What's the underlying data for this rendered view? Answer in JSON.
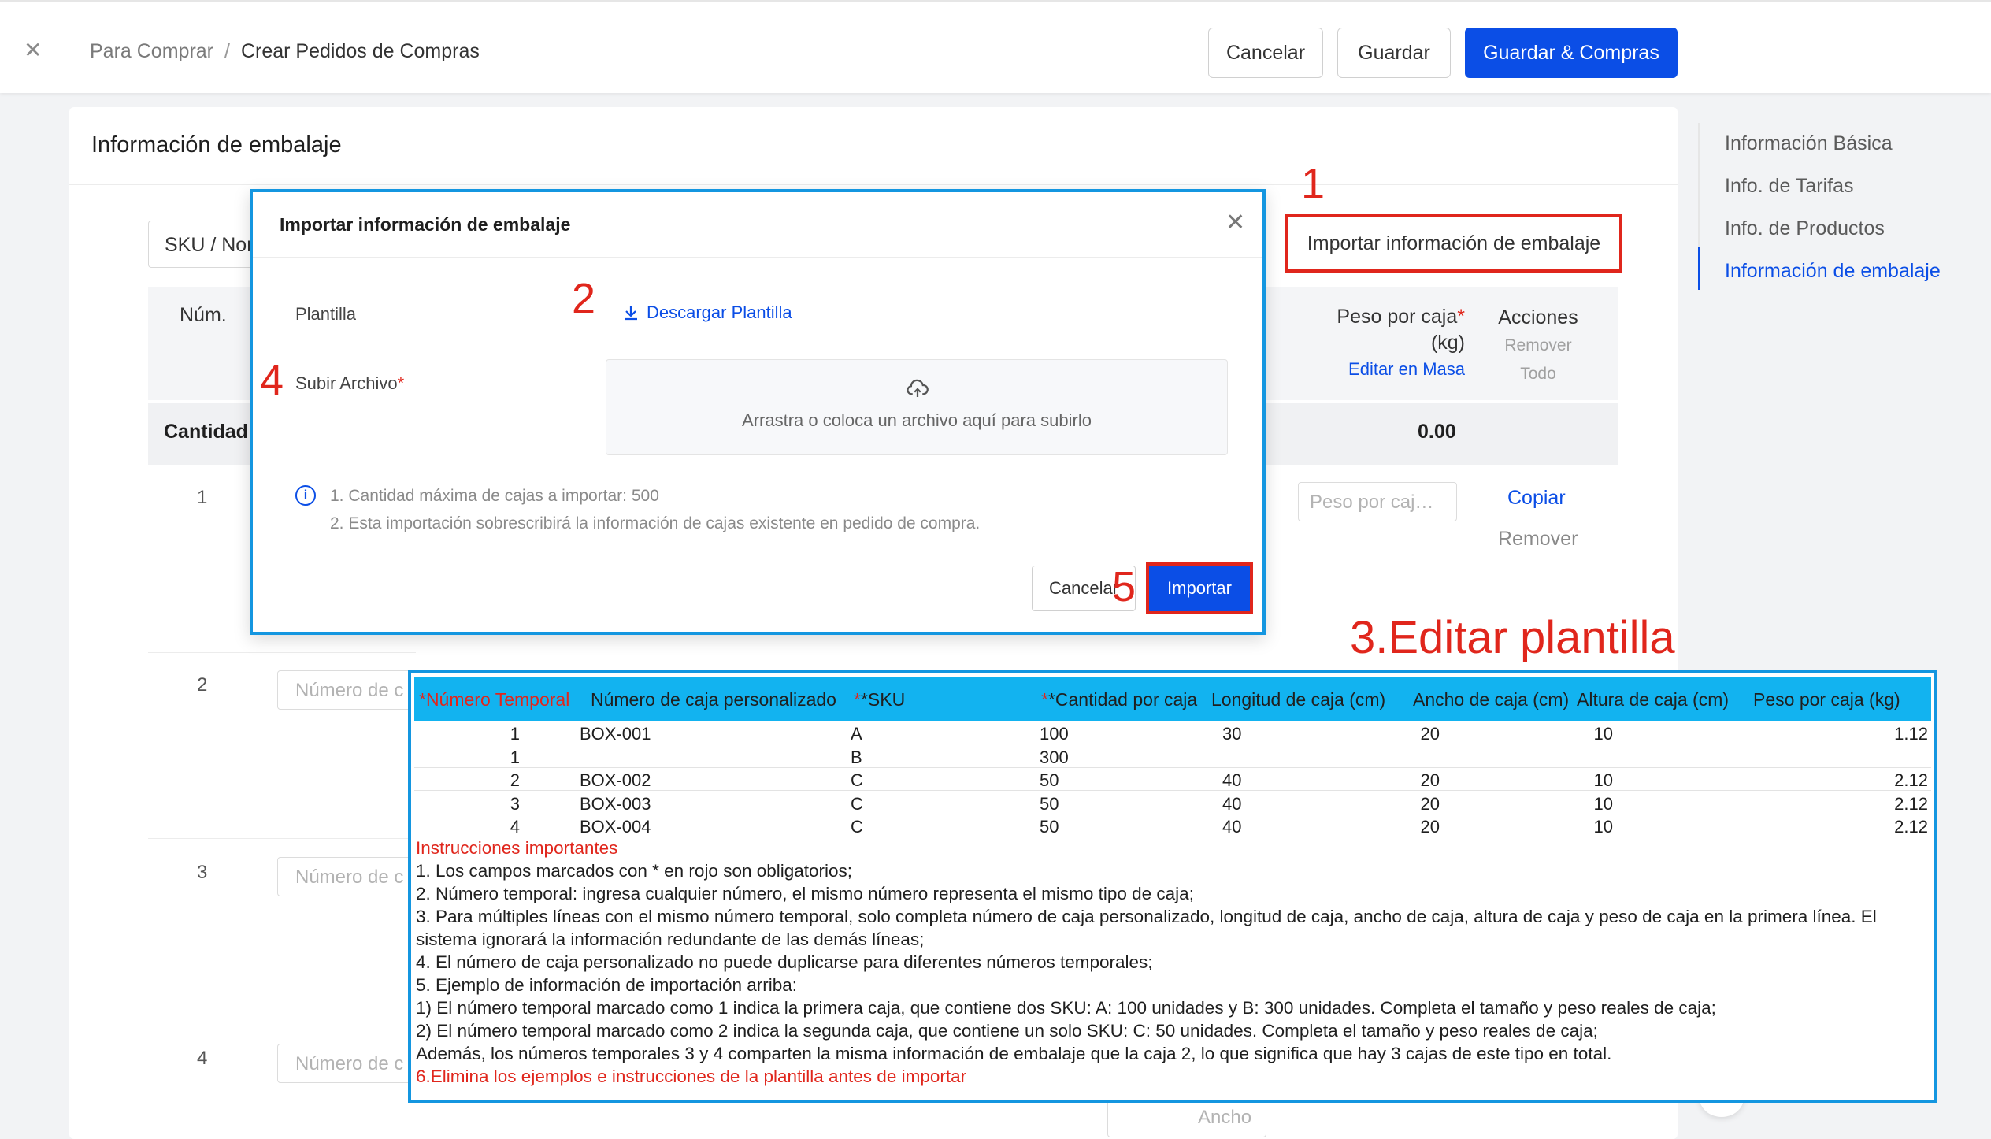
{
  "header": {
    "close_icon": "close-icon",
    "breadcrumb": [
      "Para Comprar",
      "Crear Pedidos de Compras"
    ],
    "breadcrumb_sep": "/",
    "cancel_label": "Cancelar",
    "save_label": "Guardar",
    "save_purchase_label": "Guardar & Compras"
  },
  "card": {
    "title": "Información de embalaje",
    "sku_select": "SKU / Nom",
    "import_button": "Importar información de embalaje",
    "col_num": "Núm.",
    "col_weight": "Peso por caja",
    "col_weight_req": "*",
    "col_weight_unit": "(kg)",
    "col_weight_edit": "Editar en Masa",
    "col_actions": "Acciones",
    "col_actions_remove1": "Remover",
    "col_actions_remove2": "Todo",
    "sum_label": "Cantidad",
    "sum_value": "0.00",
    "rows": [
      {
        "num": "1",
        "weight_placeholder": "Peso por caj…",
        "copy": "Copiar",
        "remove": "Remover"
      },
      {
        "num": "2",
        "box_placeholder": "Número de c"
      },
      {
        "num": "3",
        "box_placeholder": "Número de c"
      },
      {
        "num": "4",
        "box_placeholder": "Número de c"
      }
    ],
    "ancho_placeholder": "Ancho"
  },
  "anchor_nav": {
    "items": [
      "Información Básica",
      "Info. de Tarifas",
      "Info. de Productos",
      "Información de embalaje"
    ],
    "active_index": 3
  },
  "modal": {
    "title": "Importar información de embalaje",
    "template_label": "Plantilla",
    "download_label": "Descargar Plantilla",
    "upload_label": "Subir Archivo",
    "upload_req": "*",
    "dropzone_text": "Arrastra o coloca un archivo aquí para subirlo",
    "note1": "1. Cantidad máxima de cajas a importar: 500",
    "note2": "2. Esta importación sobrescribirá la información de cajas existente en pedido de compra.",
    "cancel_label": "Cancelar",
    "import_label": "Importar"
  },
  "annotations": {
    "step1": "1",
    "step2": "2",
    "step3": "3.Editar plantilla",
    "step4": "4",
    "step5": "5"
  },
  "sheet": {
    "headers": [
      "*Número Temporal",
      "Número de caja personalizado",
      "*SKU",
      "*Cantidad por caja",
      "Longitud de caja (cm)",
      "Ancho de caja (cm)",
      "Altura de caja (cm)",
      "Peso por caja (kg)"
    ],
    "rows": [
      [
        "1",
        "BOX-001",
        "A",
        "100",
        "30",
        "20",
        "10",
        "1.12"
      ],
      [
        "1",
        "",
        "B",
        "300",
        "",
        "",
        "",
        ""
      ],
      [
        "2",
        "BOX-002",
        "C",
        "50",
        "40",
        "20",
        "10",
        "2.12"
      ],
      [
        "3",
        "BOX-003",
        "C",
        "50",
        "40",
        "20",
        "10",
        "2.12"
      ],
      [
        "4",
        "BOX-004",
        "C",
        "50",
        "40",
        "20",
        "10",
        "2.12"
      ]
    ],
    "instr_title": "Instrucciones importantes",
    "instr": [
      "1. Los campos marcados con * en rojo son obligatorios;",
      "2. Número temporal: ingresa cualquier número, el mismo número representa el mismo tipo de caja;",
      "3. Para múltiples líneas con el mismo número temporal, solo completa número de caja personalizado, longitud de caja, ancho de caja, altura de caja y peso de caja en la primera línea. El",
      "sistema ignorará la información redundante de las demás líneas;",
      "4. El número de caja personalizado no puede duplicarse para diferentes números temporales;",
      "5. Ejemplo de información de importación arriba:",
      "1) El número temporal marcado como 1 indica la primera caja, que contiene dos SKU: A: 100 unidades y B: 300 unidades. Completa el tamaño y peso reales de caja;",
      "2) El número temporal marcado como 2 indica la segunda caja, que contiene un solo SKU: C: 50 unidades. Completa el tamaño y peso reales de caja;",
      "Además, los números temporales 3 y 4 comparten la misma información de embalaje que la caja 2, lo que significa que hay 3 cajas de este tipo en total."
    ],
    "instr_final": "6.Elimina los ejemplos e instrucciones de la plantilla antes de importar"
  },
  "colors": {
    "primary": "#0b4ee6",
    "annotation_red": "#e0261c",
    "highlight_blue": "#1496e0",
    "sheet_header": "#12b3f0"
  }
}
